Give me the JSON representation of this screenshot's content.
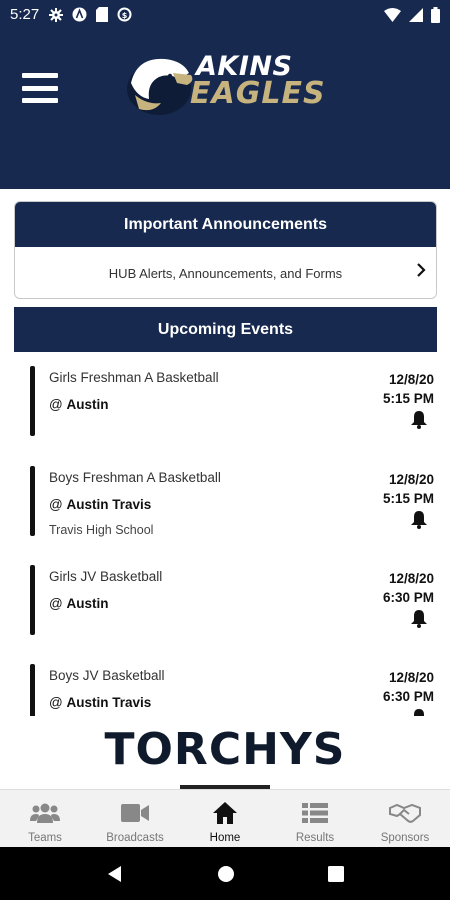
{
  "status_bar": {
    "time": "5:27"
  },
  "header": {
    "logo_line1": "AKINS",
    "logo_line2": "EAGLES"
  },
  "announcements": {
    "title": "Important Announcements",
    "link_text": "HUB Alerts, Announcements, and Forms"
  },
  "events": {
    "title": "Upcoming Events",
    "items": [
      {
        "name": "Girls Freshman A Basketball",
        "prefix": "@ ",
        "opponent": "Austin",
        "venue": "",
        "date": "12/8/20",
        "time": "5:15 PM"
      },
      {
        "name": "Boys Freshman A Basketball",
        "prefix": "@ ",
        "opponent": "Austin Travis",
        "venue": "Travis High School",
        "date": "12/8/20",
        "time": "5:15 PM"
      },
      {
        "name": "Girls JV Basketball",
        "prefix": "@ ",
        "opponent": "Austin",
        "venue": "",
        "date": "12/8/20",
        "time": "6:30 PM"
      },
      {
        "name": "Boys JV Basketball",
        "prefix": "@ ",
        "opponent": "Austin Travis",
        "venue": "",
        "date": "12/8/20",
        "time": "6:30 PM"
      }
    ]
  },
  "sponsor": {
    "name": "TORCHYS"
  },
  "bottom_nav": {
    "items": [
      {
        "label": "Teams",
        "icon": "teams-icon"
      },
      {
        "label": "Broadcasts",
        "icon": "video-camera-icon"
      },
      {
        "label": "Home",
        "icon": "home-icon"
      },
      {
        "label": "Results",
        "icon": "list-icon"
      },
      {
        "label": "Sponsors",
        "icon": "handshake-icon"
      }
    ],
    "active": "Home"
  },
  "colors": {
    "navy": "#17294f",
    "gold": "#c7b37e"
  }
}
